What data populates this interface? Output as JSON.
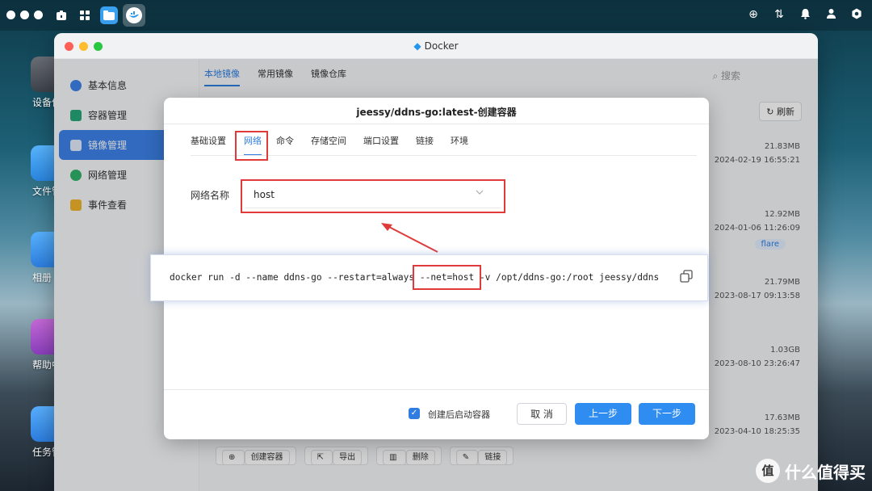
{
  "window": {
    "title": "Docker"
  },
  "sidebar": {
    "items": [
      {
        "label": "基本信息",
        "icon": "info-icon"
      },
      {
        "label": "容器管理",
        "icon": "container-icon"
      },
      {
        "label": "镜像管理",
        "icon": "image-icon"
      },
      {
        "label": "网络管理",
        "icon": "network-icon"
      },
      {
        "label": "事件查看",
        "icon": "event-icon"
      }
    ]
  },
  "main": {
    "tabs": [
      "本地镜像",
      "常用镜像",
      "镜像仓库"
    ],
    "search_placeholder": "搜索",
    "refresh_label": "刷新",
    "rows": [
      {
        "size": "21.83MB",
        "date": "2024-02-19 16:55:21"
      },
      {
        "size": "12.92MB",
        "date": "2024-01-06 11:26:09",
        "badge": "flare"
      },
      {
        "size": "21.79MB",
        "date": "2023-08-17 09:13:58"
      },
      {
        "size": "1.03GB",
        "date": "2023-08-10 23:26:47"
      },
      {
        "size": "17.63MB",
        "date": "2023-04-10 18:25:35"
      }
    ],
    "actions": [
      "创建容器",
      "导出",
      "删除",
      "链接"
    ]
  },
  "desktop": {
    "labels": [
      "设备信",
      "文件管",
      "相册",
      "帮助中",
      "任务管"
    ]
  },
  "dialog": {
    "title": "jeessy/ddns-go:latest-创建容器",
    "tabs": [
      "基础设置",
      "网络",
      "命令",
      "存储空间",
      "端口设置",
      "链接",
      "环境"
    ],
    "field_label": "网络名称",
    "network_value": "host",
    "start_after_create_label": "创建后启动容器",
    "cancel_label": "取 消",
    "prev_label": "上一步",
    "next_label": "下一步"
  },
  "command": {
    "prefix": "docker run -d --name ddns-go --restart=always ",
    "highlight": "--net=host",
    "suffix": " -v /opt/ddns-go:/root jeessy/ddns"
  },
  "watermark": {
    "logo": "值",
    "text": "什么值得买"
  },
  "colors": {
    "accent": "#2f7de1",
    "highlight_border": "#e03a3a",
    "sidebar_active": "#3c82e8"
  }
}
